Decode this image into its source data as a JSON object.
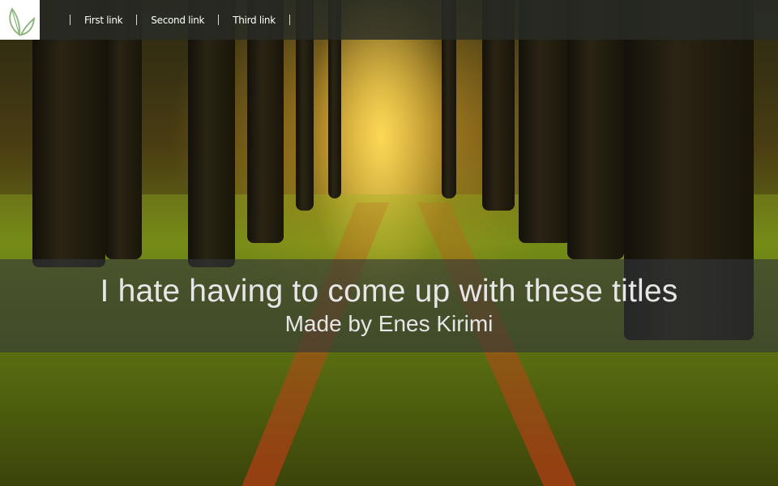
{
  "navbar": {
    "logo_icon": "leaf-icon",
    "links": [
      {
        "label": "First link"
      },
      {
        "label": "Second link"
      },
      {
        "label": "Third link"
      }
    ]
  },
  "hero": {
    "title": "I hate having to come up with these titles",
    "subtitle": "Made by Enes Kirimi"
  },
  "colors": {
    "logo_leaf": "#8bb37a",
    "nav_background": "#282c26",
    "band_background": "#32363a",
    "text": "#e6e6e6"
  }
}
